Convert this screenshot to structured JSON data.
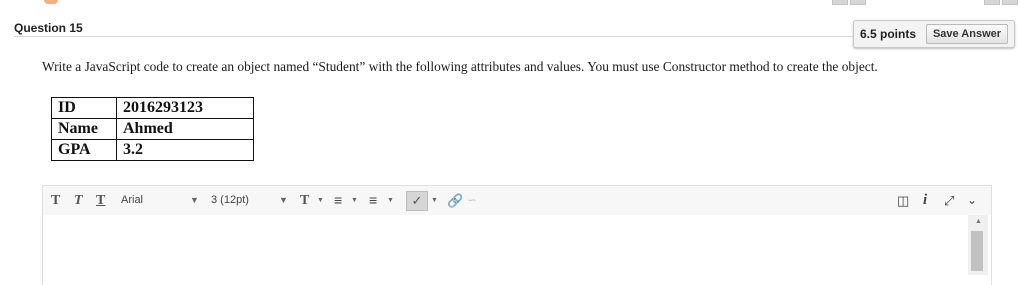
{
  "question": {
    "title": "Question 15",
    "points": "6.5 points",
    "save_label": "Save Answer",
    "prompt": "Write a JavaScript code to create an object named “Student” with the following attributes and values. You must use Constructor method to create the object.",
    "table": [
      {
        "key": "ID",
        "value": "2016293123"
      },
      {
        "key": "Name",
        "value": "Ahmed"
      },
      {
        "key": "GPA",
        "value": "3.2"
      }
    ]
  },
  "toolbar": {
    "bold_glyph": "T",
    "italic_glyph": "T",
    "underline_glyph": "T",
    "font_family": "Arial",
    "font_size": "3 (12pt)",
    "text_color_glyph": "T",
    "icons": [
      "bold-icon",
      "italic-icon",
      "underline-icon",
      "text-color-icon",
      "bullet-list-icon",
      "numbered-list-icon",
      "spellcheck-icon",
      "link-icon",
      "unlink-icon",
      "preview-icon",
      "info-icon",
      "fullscreen-icon",
      "expand-toolbar-icon"
    ]
  }
}
